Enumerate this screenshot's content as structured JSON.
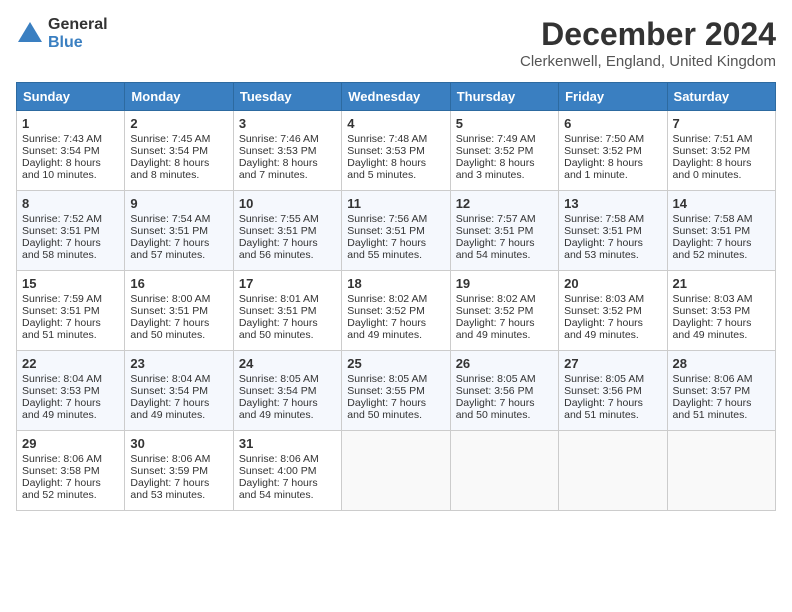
{
  "header": {
    "logo_general": "General",
    "logo_blue": "Blue",
    "month_title": "December 2024",
    "location": "Clerkenwell, England, United Kingdom"
  },
  "weekdays": [
    "Sunday",
    "Monday",
    "Tuesday",
    "Wednesday",
    "Thursday",
    "Friday",
    "Saturday"
  ],
  "weeks": [
    [
      {
        "day": 1,
        "sunrise": "7:43 AM",
        "sunset": "3:54 PM",
        "daylight": "8 hours and 10 minutes."
      },
      {
        "day": 2,
        "sunrise": "7:45 AM",
        "sunset": "3:54 PM",
        "daylight": "8 hours and 8 minutes."
      },
      {
        "day": 3,
        "sunrise": "7:46 AM",
        "sunset": "3:53 PM",
        "daylight": "8 hours and 7 minutes."
      },
      {
        "day": 4,
        "sunrise": "7:48 AM",
        "sunset": "3:53 PM",
        "daylight": "8 hours and 5 minutes."
      },
      {
        "day": 5,
        "sunrise": "7:49 AM",
        "sunset": "3:52 PM",
        "daylight": "8 hours and 3 minutes."
      },
      {
        "day": 6,
        "sunrise": "7:50 AM",
        "sunset": "3:52 PM",
        "daylight": "8 hours and 1 minute."
      },
      {
        "day": 7,
        "sunrise": "7:51 AM",
        "sunset": "3:52 PM",
        "daylight": "8 hours and 0 minutes."
      }
    ],
    [
      {
        "day": 8,
        "sunrise": "7:52 AM",
        "sunset": "3:51 PM",
        "daylight": "7 hours and 58 minutes."
      },
      {
        "day": 9,
        "sunrise": "7:54 AM",
        "sunset": "3:51 PM",
        "daylight": "7 hours and 57 minutes."
      },
      {
        "day": 10,
        "sunrise": "7:55 AM",
        "sunset": "3:51 PM",
        "daylight": "7 hours and 56 minutes."
      },
      {
        "day": 11,
        "sunrise": "7:56 AM",
        "sunset": "3:51 PM",
        "daylight": "7 hours and 55 minutes."
      },
      {
        "day": 12,
        "sunrise": "7:57 AM",
        "sunset": "3:51 PM",
        "daylight": "7 hours and 54 minutes."
      },
      {
        "day": 13,
        "sunrise": "7:58 AM",
        "sunset": "3:51 PM",
        "daylight": "7 hours and 53 minutes."
      },
      {
        "day": 14,
        "sunrise": "7:58 AM",
        "sunset": "3:51 PM",
        "daylight": "7 hours and 52 minutes."
      }
    ],
    [
      {
        "day": 15,
        "sunrise": "7:59 AM",
        "sunset": "3:51 PM",
        "daylight": "7 hours and 51 minutes."
      },
      {
        "day": 16,
        "sunrise": "8:00 AM",
        "sunset": "3:51 PM",
        "daylight": "7 hours and 50 minutes."
      },
      {
        "day": 17,
        "sunrise": "8:01 AM",
        "sunset": "3:51 PM",
        "daylight": "7 hours and 50 minutes."
      },
      {
        "day": 18,
        "sunrise": "8:02 AM",
        "sunset": "3:52 PM",
        "daylight": "7 hours and 49 minutes."
      },
      {
        "day": 19,
        "sunrise": "8:02 AM",
        "sunset": "3:52 PM",
        "daylight": "7 hours and 49 minutes."
      },
      {
        "day": 20,
        "sunrise": "8:03 AM",
        "sunset": "3:52 PM",
        "daylight": "7 hours and 49 minutes."
      },
      {
        "day": 21,
        "sunrise": "8:03 AM",
        "sunset": "3:53 PM",
        "daylight": "7 hours and 49 minutes."
      }
    ],
    [
      {
        "day": 22,
        "sunrise": "8:04 AM",
        "sunset": "3:53 PM",
        "daylight": "7 hours and 49 minutes."
      },
      {
        "day": 23,
        "sunrise": "8:04 AM",
        "sunset": "3:54 PM",
        "daylight": "7 hours and 49 minutes."
      },
      {
        "day": 24,
        "sunrise": "8:05 AM",
        "sunset": "3:54 PM",
        "daylight": "7 hours and 49 minutes."
      },
      {
        "day": 25,
        "sunrise": "8:05 AM",
        "sunset": "3:55 PM",
        "daylight": "7 hours and 50 minutes."
      },
      {
        "day": 26,
        "sunrise": "8:05 AM",
        "sunset": "3:56 PM",
        "daylight": "7 hours and 50 minutes."
      },
      {
        "day": 27,
        "sunrise": "8:05 AM",
        "sunset": "3:56 PM",
        "daylight": "7 hours and 51 minutes."
      },
      {
        "day": 28,
        "sunrise": "8:06 AM",
        "sunset": "3:57 PM",
        "daylight": "7 hours and 51 minutes."
      }
    ],
    [
      {
        "day": 29,
        "sunrise": "8:06 AM",
        "sunset": "3:58 PM",
        "daylight": "7 hours and 52 minutes."
      },
      {
        "day": 30,
        "sunrise": "8:06 AM",
        "sunset": "3:59 PM",
        "daylight": "7 hours and 53 minutes."
      },
      {
        "day": 31,
        "sunrise": "8:06 AM",
        "sunset": "4:00 PM",
        "daylight": "7 hours and 54 minutes."
      },
      null,
      null,
      null,
      null
    ]
  ]
}
